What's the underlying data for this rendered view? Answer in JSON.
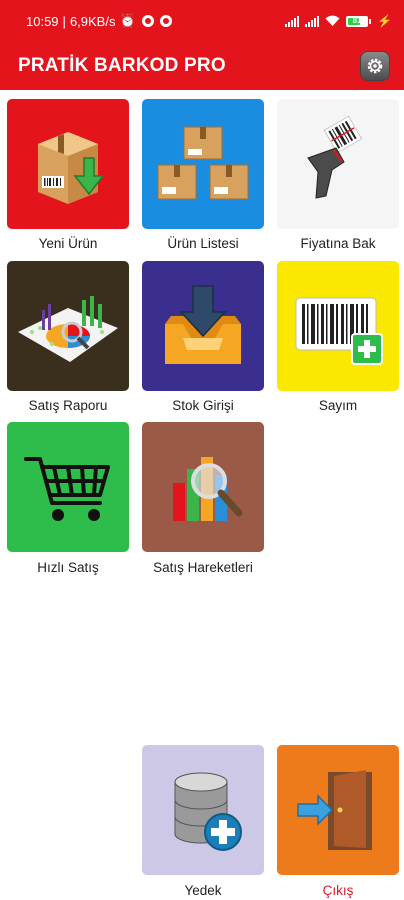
{
  "status_bar": {
    "time": "10:59",
    "network_speed": "6,9KB/s",
    "battery_percent": "81"
  },
  "app_bar": {
    "title": "PRATİK BARKOD PRO",
    "settings_icon": "gear-icon"
  },
  "menu": [
    {
      "label": "Yeni Ürün",
      "color": "#e4141d",
      "icon": "new-product-box-icon"
    },
    {
      "label": "Ürün Listesi",
      "color": "#1a8de0",
      "icon": "product-boxes-icon"
    },
    {
      "label": "Fiyatına Bak",
      "color": "#f5f5f5",
      "icon": "barcode-scanner-icon"
    },
    {
      "label": "Satış Raporu",
      "color": "#3a2e1d",
      "icon": "sales-report-chart-icon"
    },
    {
      "label": "Stok Girişi",
      "color": "#3a2f8e",
      "icon": "stock-inbox-icon"
    },
    {
      "label": "Sayım",
      "color": "#fbe800",
      "icon": "barcode-add-icon"
    },
    {
      "label": "Hızlı Satış",
      "color": "#2ebd4a",
      "icon": "shopping-cart-icon"
    },
    {
      "label": "Satış Hareketleri",
      "color": "#9a5a47",
      "icon": "bar-chart-magnifier-icon"
    }
  ],
  "bottom": [
    {
      "label": "Yedek",
      "color": "#cdc8e6",
      "icon": "database-add-icon"
    },
    {
      "label": "Çıkış",
      "color": "#ee7b1b",
      "icon": "exit-door-icon"
    }
  ]
}
